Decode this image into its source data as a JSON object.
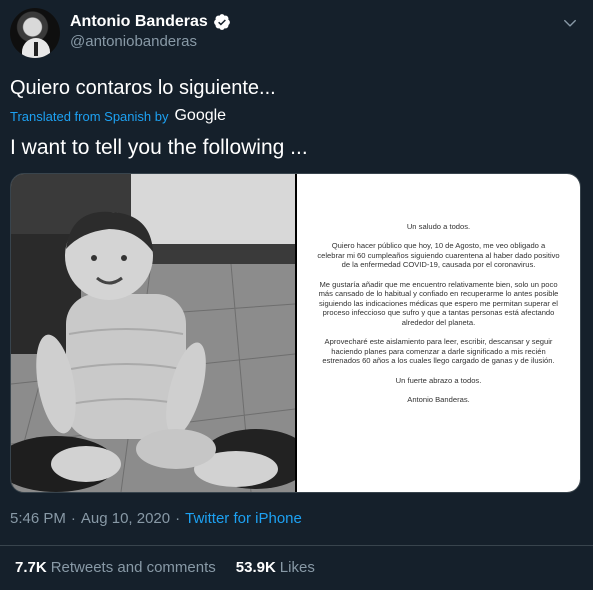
{
  "author": {
    "display_name": "Antonio Banderas",
    "handle": "@antoniobanderas"
  },
  "tweet": {
    "text": "Quiero contaros lo siguiente...",
    "translated_label": "Translated from Spanish by",
    "translator": "Google",
    "translation": "I want to tell you the following ..."
  },
  "letter": {
    "greeting": "Un saludo a todos.",
    "paragraph1": "Quiero hacer público que hoy, 10 de Agosto, me veo obligado a celebrar mi 60 cumpleaños siguiendo cuarentena al haber dado positivo de la enfermedad COVID-19, causada por el coronavirus.",
    "paragraph2": "Me gustaría añadir que me encuentro relativamente bien, solo un poco más cansado de lo habitual y confiado en recuperarme lo antes posible siguiendo las indicaciones médicas que espero me permitan superar el proceso infeccioso que sufro y que a tantas personas está afectando alrededor del planeta.",
    "paragraph3": "Aprovecharé este aislamiento para leer, escribir, descansar y seguir haciendo planes para comenzar a darle significado a mis recién estrenados 60 años a los cuales llego cargado de ganas y de ilusión.",
    "closing": "Un fuerte abrazo a todos.",
    "signature": "Antonio Banderas."
  },
  "meta": {
    "time": "5:46 PM",
    "separator1": "·",
    "date": "Aug 10, 2020",
    "separator2": "·",
    "source": "Twitter for iPhone"
  },
  "stats": {
    "retweets_count": "7.7K",
    "retweets_label": "Retweets and comments",
    "likes_count": "53.9K",
    "likes_label": "Likes"
  },
  "colors": {
    "background": "#15202b",
    "accent": "#1da1f2",
    "secondary_text": "#8899a6"
  }
}
